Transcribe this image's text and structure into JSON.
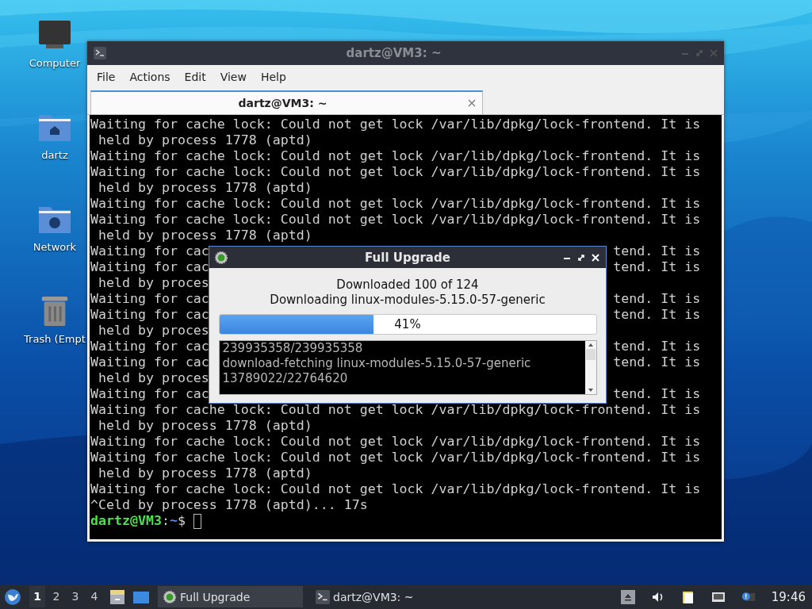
{
  "desktop_icons": [
    {
      "label": "Computer",
      "kind": "computer"
    },
    {
      "label": "dartz",
      "kind": "home"
    },
    {
      "label": "Network",
      "kind": "network"
    },
    {
      "label": "Trash (Empt",
      "kind": "trash"
    }
  ],
  "terminal": {
    "title": "dartz@VM3: ~",
    "menu": [
      "File",
      "Actions",
      "Edit",
      "View",
      "Help"
    ],
    "tabs": [
      {
        "label": "dartz@VM3: ~",
        "selected": true
      }
    ],
    "lines": [
      {
        "text": "Waiting for cache lock: Could not get lock /var/lib/dpkg/lock-frontend. It is"
      },
      {
        "text": " held by process 1778 (aptd)"
      },
      {
        "text": "Waiting for cache lock: Could not get lock /var/lib/dpkg/lock-frontend. It is"
      },
      {
        "text": "Waiting for cache lock: Could not get lock /var/lib/dpkg/lock-frontend. It is"
      },
      {
        "text": " held by process 1778 (aptd)"
      },
      {
        "text": "Waiting for cache lock: Could not get lock /var/lib/dpkg/lock-frontend. It is"
      },
      {
        "text": "Waiting for cache lock: Could not get lock /var/lib/dpkg/lock-frontend. It is"
      },
      {
        "text": " held by process 1778 (aptd)"
      },
      {
        "text": "Waiting for cac",
        "right": "tend. It is"
      },
      {
        "text": "Waiting for cac",
        "right": "tend. It is"
      },
      {
        "text": " held by proces"
      },
      {
        "text": "Waiting for cac",
        "right": "tend. It is"
      },
      {
        "text": "Waiting for cac",
        "right": "tend. It is"
      },
      {
        "text": " held by proces"
      },
      {
        "text": "Waiting for cac",
        "right": "tend. It is"
      },
      {
        "text": "Waiting for cac",
        "right": "tend. It is"
      },
      {
        "text": " held by proces"
      },
      {
        "text": "Waiting for cac",
        "right": "tend. It is"
      },
      {
        "text": "Waiting for cache lock: Could not get lock /var/lib/dpkg/lock-frontend. It is"
      },
      {
        "text": " held by process 1778 (aptd)"
      },
      {
        "text": "Waiting for cache lock: Could not get lock /var/lib/dpkg/lock-frontend. It is"
      },
      {
        "text": "Waiting for cache lock: Could not get lock /var/lib/dpkg/lock-frontend. It is"
      },
      {
        "text": " held by process 1778 (aptd)"
      },
      {
        "text": "Waiting for cache lock: Could not get lock /var/lib/dpkg/lock-frontend. It is"
      },
      {
        "text": "^Celd by process 1778 (aptd)... 17s"
      }
    ],
    "prompt": {
      "user": "dartz@VM3",
      "separator": ":",
      "path": "~",
      "symbol": "$"
    }
  },
  "dialog": {
    "title": "Full Upgrade",
    "status": "Downloaded 100 of 124",
    "detail": "Downloading linux-modules-5.15.0-57-generic",
    "progress": {
      "level": 0.41,
      "label": "41%"
    },
    "log": [
      "239935358/239935358",
      "download-fetching linux-modules-5.15.0-57-generic",
      "13789022/22764620"
    ]
  },
  "taskbar": {
    "workspaces": [
      {
        "label": "1",
        "selected": true
      },
      {
        "label": "2",
        "selected": false
      },
      {
        "label": "3",
        "selected": false
      },
      {
        "label": "4",
        "selected": false
      }
    ],
    "tasks": [
      {
        "label": "Full Upgrade",
        "kind": "upgrade",
        "selected": true
      },
      {
        "label": "dartz@VM3: ~",
        "kind": "terminal",
        "selected": false
      }
    ],
    "clock": "19:46"
  }
}
